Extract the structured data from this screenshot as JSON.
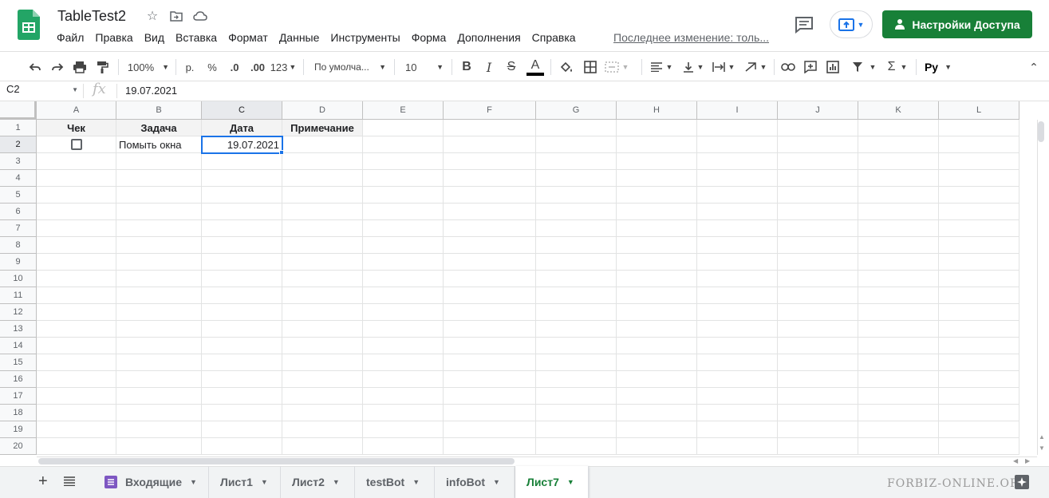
{
  "document": {
    "title": "TableTest2",
    "last_edit": "Последнее изменение: толь..."
  },
  "menu": [
    "Файл",
    "Правка",
    "Вид",
    "Вставка",
    "Формат",
    "Данные",
    "Инструменты",
    "Форма",
    "Дополнения",
    "Справка"
  ],
  "share_button": {
    "label": "Настройки Доступа",
    "color": "#188038"
  },
  "toolbar": {
    "zoom": "100%",
    "currency": "р.",
    "percent": "%",
    "decrease_decimal": ".0",
    "increase_decimal": ".00",
    "more_formats": "123",
    "font": "По умолча...",
    "font_size": "10",
    "bold": "B",
    "italic": "I",
    "strike": "S",
    "text_color": "A",
    "input_tools": "Py"
  },
  "formula_bar": {
    "name_box": "C2",
    "fx": "fx",
    "value": "19.07.2021"
  },
  "columns": [
    "A",
    "B",
    "C",
    "D",
    "E",
    "F",
    "G",
    "H",
    "I",
    "J",
    "K",
    "L"
  ],
  "rows": [
    "1",
    "2",
    "3",
    "4",
    "5",
    "6",
    "7",
    "8",
    "9",
    "10",
    "11",
    "12",
    "13",
    "14",
    "15",
    "16",
    "17",
    "18",
    "19",
    "20"
  ],
  "cells": {
    "A1": "Чек",
    "B1": "Задача",
    "C1": "Дата",
    "D1": "Примечание",
    "B2": "Помыть окна",
    "C2": "19.07.2021",
    "A2_checked": false
  },
  "selected_cell": "C2",
  "sheets": [
    {
      "name": "Входящие",
      "active": false,
      "has_icon": true
    },
    {
      "name": "Лист1",
      "active": false
    },
    {
      "name": "Лист2",
      "active": false
    },
    {
      "name": "testBot",
      "active": false
    },
    {
      "name": "infoBot",
      "active": false
    },
    {
      "name": "Лист7",
      "active": true
    }
  ],
  "watermark": "FORBIZ-ONLINE.ORG",
  "colors": {
    "brand_green": "#188038",
    "selection_blue": "#1a73e8",
    "sheets_icon": "#23a566"
  }
}
